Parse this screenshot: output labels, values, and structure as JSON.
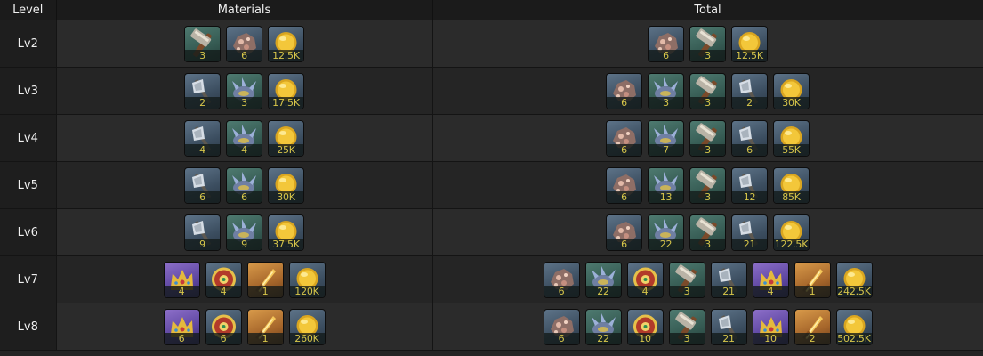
{
  "headers": {
    "level": "Level",
    "materials": "Materials",
    "total": "Total"
  },
  "icons": {
    "mat_hammer": {
      "name": "hammer-icon",
      "bg": "teal"
    },
    "mat_ore": {
      "name": "ore-icon",
      "bg": "blue"
    },
    "mat_axe": {
      "name": "axe-icon",
      "bg": "blue"
    },
    "mat_shell": {
      "name": "spiked-shell-icon",
      "bg": "teal"
    },
    "mat_crown": {
      "name": "crown-icon",
      "bg": "purple"
    },
    "mat_orb": {
      "name": "ornament-orb-icon",
      "bg": "blue"
    },
    "mat_blade": {
      "name": "golden-blade-icon",
      "bg": "orange"
    },
    "gold": {
      "name": "gold-coin-icon",
      "bg": "blue"
    }
  },
  "rows": [
    {
      "level": "Lv2",
      "materials": [
        {
          "icon": "mat_hammer",
          "qty": "3"
        },
        {
          "icon": "mat_ore",
          "qty": "6"
        },
        {
          "icon": "gold",
          "qty": "12.5K"
        }
      ],
      "total": [
        {
          "icon": "mat_ore",
          "qty": "6"
        },
        {
          "icon": "mat_hammer",
          "qty": "3"
        },
        {
          "icon": "gold",
          "qty": "12.5K"
        }
      ]
    },
    {
      "level": "Lv3",
      "materials": [
        {
          "icon": "mat_axe",
          "qty": "2"
        },
        {
          "icon": "mat_shell",
          "qty": "3"
        },
        {
          "icon": "gold",
          "qty": "17.5K"
        }
      ],
      "total": [
        {
          "icon": "mat_ore",
          "qty": "6"
        },
        {
          "icon": "mat_shell",
          "qty": "3"
        },
        {
          "icon": "mat_hammer",
          "qty": "3"
        },
        {
          "icon": "mat_axe",
          "qty": "2"
        },
        {
          "icon": "gold",
          "qty": "30K"
        }
      ]
    },
    {
      "level": "Lv4",
      "materials": [
        {
          "icon": "mat_axe",
          "qty": "4"
        },
        {
          "icon": "mat_shell",
          "qty": "4"
        },
        {
          "icon": "gold",
          "qty": "25K"
        }
      ],
      "total": [
        {
          "icon": "mat_ore",
          "qty": "6"
        },
        {
          "icon": "mat_shell",
          "qty": "7"
        },
        {
          "icon": "mat_hammer",
          "qty": "3"
        },
        {
          "icon": "mat_axe",
          "qty": "6"
        },
        {
          "icon": "gold",
          "qty": "55K"
        }
      ]
    },
    {
      "level": "Lv5",
      "materials": [
        {
          "icon": "mat_axe",
          "qty": "6"
        },
        {
          "icon": "mat_shell",
          "qty": "6"
        },
        {
          "icon": "gold",
          "qty": "30K"
        }
      ],
      "total": [
        {
          "icon": "mat_ore",
          "qty": "6"
        },
        {
          "icon": "mat_shell",
          "qty": "13"
        },
        {
          "icon": "mat_hammer",
          "qty": "3"
        },
        {
          "icon": "mat_axe",
          "qty": "12"
        },
        {
          "icon": "gold",
          "qty": "85K"
        }
      ]
    },
    {
      "level": "Lv6",
      "materials": [
        {
          "icon": "mat_axe",
          "qty": "9"
        },
        {
          "icon": "mat_shell",
          "qty": "9"
        },
        {
          "icon": "gold",
          "qty": "37.5K"
        }
      ],
      "total": [
        {
          "icon": "mat_ore",
          "qty": "6"
        },
        {
          "icon": "mat_shell",
          "qty": "22"
        },
        {
          "icon": "mat_hammer",
          "qty": "3"
        },
        {
          "icon": "mat_axe",
          "qty": "21"
        },
        {
          "icon": "gold",
          "qty": "122.5K"
        }
      ]
    },
    {
      "level": "Lv7",
      "materials": [
        {
          "icon": "mat_crown",
          "qty": "4"
        },
        {
          "icon": "mat_orb",
          "qty": "4"
        },
        {
          "icon": "mat_blade",
          "qty": "1"
        },
        {
          "icon": "gold",
          "qty": "120K"
        }
      ],
      "total": [
        {
          "icon": "mat_ore",
          "qty": "6"
        },
        {
          "icon": "mat_shell",
          "qty": "22"
        },
        {
          "icon": "mat_orb",
          "qty": "4"
        },
        {
          "icon": "mat_hammer",
          "qty": "3"
        },
        {
          "icon": "mat_axe",
          "qty": "21"
        },
        {
          "icon": "mat_crown",
          "qty": "4"
        },
        {
          "icon": "mat_blade",
          "qty": "1"
        },
        {
          "icon": "gold",
          "qty": "242.5K"
        }
      ]
    },
    {
      "level": "Lv8",
      "materials": [
        {
          "icon": "mat_crown",
          "qty": "6"
        },
        {
          "icon": "mat_orb",
          "qty": "6"
        },
        {
          "icon": "mat_blade",
          "qty": "1"
        },
        {
          "icon": "gold",
          "qty": "260K"
        }
      ],
      "total": [
        {
          "icon": "mat_ore",
          "qty": "6"
        },
        {
          "icon": "mat_shell",
          "qty": "22"
        },
        {
          "icon": "mat_orb",
          "qty": "10"
        },
        {
          "icon": "mat_hammer",
          "qty": "3"
        },
        {
          "icon": "mat_axe",
          "qty": "21"
        },
        {
          "icon": "mat_crown",
          "qty": "10"
        },
        {
          "icon": "mat_blade",
          "qty": "2"
        },
        {
          "icon": "gold",
          "qty": "502.5K"
        }
      ]
    }
  ]
}
